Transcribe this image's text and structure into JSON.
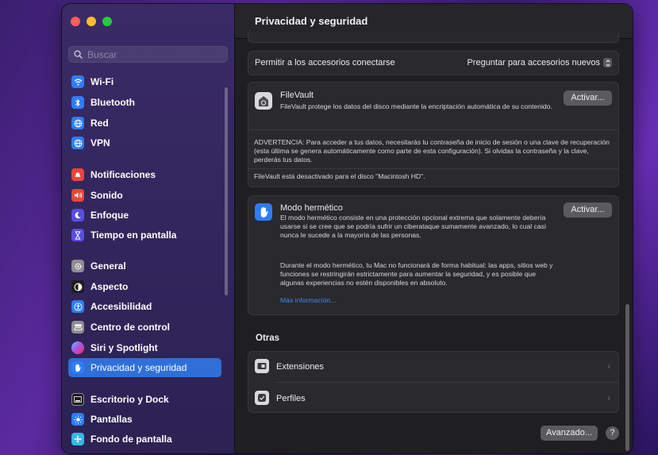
{
  "window": {
    "title": "Privacidad y seguridad"
  },
  "colors": {
    "close": "#ff5f57",
    "minimize": "#febc2e",
    "zoom": "#28c840",
    "accent": "#2f6fd8",
    "link": "#3c8cf0"
  },
  "search": {
    "placeholder": "Buscar"
  },
  "sidebar": {
    "items": [
      {
        "label": "Wi-Fi",
        "icon": "wifi-icon",
        "color": "#2f7cf6"
      },
      {
        "label": "Bluetooth",
        "icon": "bluetooth-icon",
        "color": "#2f7cf6"
      },
      {
        "label": "Red",
        "icon": "globe-icon",
        "color": "#2f7cf6"
      },
      {
        "label": "VPN",
        "icon": "vpn-globe-icon",
        "color": "#2f7cf6"
      },
      {
        "label": "Notificaciones",
        "icon": "bell-icon",
        "color": "#e8453c"
      },
      {
        "label": "Sonido",
        "icon": "speaker-icon",
        "color": "#e8453c"
      },
      {
        "label": "Enfoque",
        "icon": "moon-icon",
        "color": "#5a4de0"
      },
      {
        "label": "Tiempo en pantalla",
        "icon": "hourglass-icon",
        "color": "#5a4de0"
      },
      {
        "label": "General",
        "icon": "gear-icon",
        "color": "#8e8e93"
      },
      {
        "label": "Aspecto",
        "icon": "appearance-icon",
        "color": "#1c1c1e"
      },
      {
        "label": "Accesibilidad",
        "icon": "accessibility-icon",
        "color": "#2f7cf6"
      },
      {
        "label": "Centro de control",
        "icon": "control-center-icon",
        "color": "#8e8e93"
      },
      {
        "label": "Siri y Spotlight",
        "icon": "siri-icon",
        "color": "#b04de0"
      },
      {
        "label": "Privacidad y seguridad",
        "icon": "hand-icon",
        "color": "#2f7cf6",
        "selected": true
      },
      {
        "label": "Escritorio y Dock",
        "icon": "dock-icon",
        "color": "#1c1c1e"
      },
      {
        "label": "Pantallas",
        "icon": "sun-icon",
        "color": "#2f7cf6"
      },
      {
        "label": "Fondo de pantalla",
        "icon": "wallpaper-icon",
        "color": "#38b6e8"
      }
    ]
  },
  "accessories": {
    "label": "Permitir a los accesorios conectarse",
    "value": "Preguntar para accesorios nuevos"
  },
  "filevault": {
    "title": "FileVault",
    "description": "FileVault protege los datos del disco mediante la encriptación automática de su contenido.",
    "button": "Activar...",
    "warning": "ADVERTENCIA: Para acceder a tus datos, necesitarás tu contraseña de inicio de sesión o una clave de recuperación (esta última se genera automáticamente como parte de esta configuración). Si olvidas la contraseña y la clave, perderás tus datos.",
    "status": "FileVault está desactivado para el disco \"Macintosh HD\"."
  },
  "lockdown": {
    "title": "Modo hermético",
    "description": "El modo hermético consiste en una protección opcional extrema que solamente debería usarse si se cree que se podría sufrir un ciberataque sumamente avanzado, lo cual casi nunca le sucede a la mayoría de las personas.",
    "detail": "Durante el modo hermético, tu Mac no funcionará de forma habitual: las apps, sitios web y funciones se restringirán estrictamente para aumentar la seguridad, y es posible que algunas experiencias no estén disponibles en absoluto.",
    "link": "Más información...",
    "button": "Activar..."
  },
  "others": {
    "heading": "Otras",
    "items": [
      {
        "label": "Extensiones",
        "icon": "extensions-icon"
      },
      {
        "label": "Perfiles",
        "icon": "profiles-icon"
      }
    ]
  },
  "footer": {
    "advanced": "Avanzado...",
    "help": "?"
  }
}
